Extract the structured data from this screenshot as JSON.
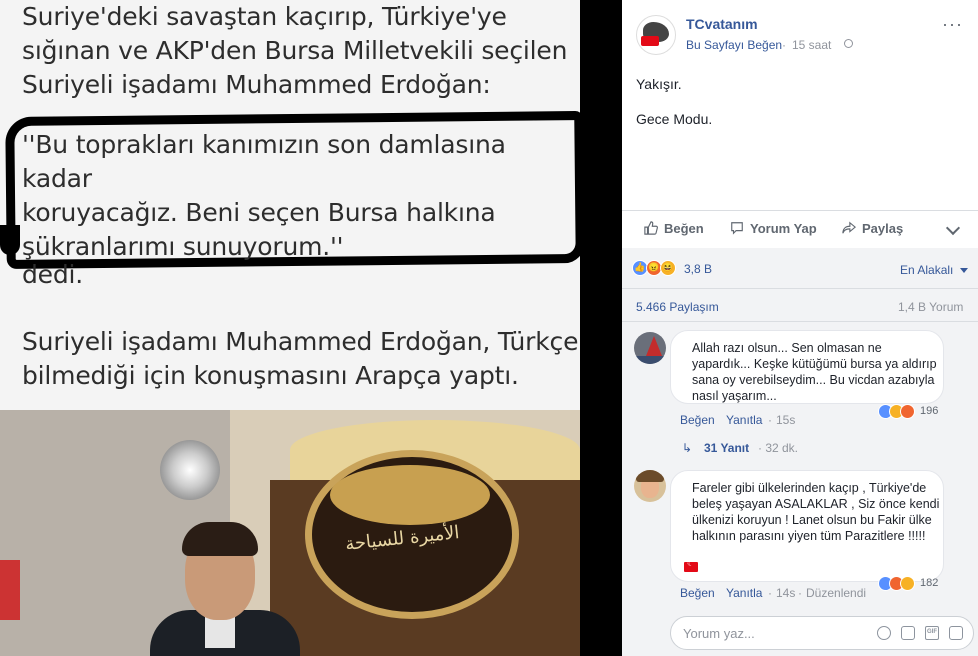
{
  "post_image": {
    "paragraph_1": "Suriye'deki savaştan kaçırıp, Türkiye'ye\nsığınan ve AKP'den Bursa Milletvekili seçilen\nSuriyeli işadamı Muhammed Erdoğan:",
    "quote": "''Bu toprakları kanımızın son damlasına kadar\nkoruyacağız. Beni seçen Bursa halkına\nşükranlarımı sunuyorum.''",
    "said": "dedi.",
    "paragraph_2": "Suriyeli işadamı Muhammed Erdoğan, Türkçe\nbilmediği için konuşmasını Arapça yaptı.",
    "sign_text": "الأميرة للسياحة"
  },
  "post": {
    "page_name": "TCvatanım",
    "like_page": "Bu Sayfayı Beğen",
    "separator": "·",
    "time": "15 saat",
    "more": "···",
    "text_1": "Yakışır.",
    "text_2": "Gece Modu."
  },
  "actions": {
    "like": "Beğen",
    "comment": "Yorum Yap",
    "share": "Paylaş"
  },
  "stats": {
    "reactions_count": "3,8 B",
    "sort": "En Alakalı",
    "shares": "5.466 Paylaşım",
    "views": "1,4 B Yorum"
  },
  "comments": [
    {
      "text": "Allah razı olsun... Sen olmasan ne yapardık... Keşke kütüğümü bursa ya aldırıp sana oy verebilseydim... Bu vicdan azabıyla nasıl yaşarım...",
      "reaction_count": "196",
      "like": "Beğen",
      "reply": "Yanıtla",
      "dot": "·",
      "time": "15s",
      "replies_arrow": "↳",
      "replies": "31 Yanıt",
      "replies_time": "· 32 dk."
    },
    {
      "text": "Fareler gibi ülkelerinden kaçıp , Türkiye'de beleş yaşayan ASALAKLAR , Siz önce kendi ülkenizi koruyun ! Lanet olsun bu Fakir ülke halkının parasını yiyen tüm Parazitlere !!!!!",
      "reaction_count": "182",
      "like": "Beğen",
      "reply": "Yanıtla",
      "dot": "·",
      "time": "14s",
      "dot2": "·",
      "edited": "Düzenlendi"
    }
  ],
  "composer": {
    "placeholder": "Yorum yaz...",
    "gif": "GIF"
  },
  "colors": {
    "link": "#365899",
    "like_reaction": "#5890ff",
    "angry_reaction": "#f0652f",
    "haha_reaction": "#f7b125",
    "turkish_flag": "#e30a17"
  }
}
